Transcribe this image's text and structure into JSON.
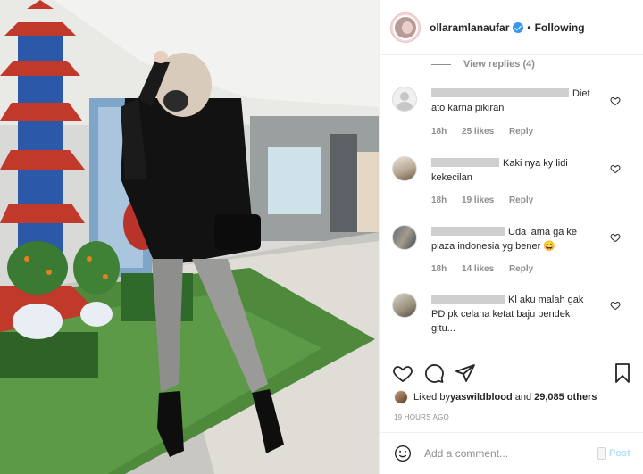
{
  "header": {
    "username": "ollaramlanaufar",
    "separator": "•",
    "follow_state": "Following"
  },
  "view_replies": "View replies (4)",
  "comments": [
    {
      "username": "",
      "text_line1": "Diet",
      "text_line2": "ato karna pikiran",
      "time": "18h",
      "likes": "25 likes",
      "reply": "Reply"
    },
    {
      "username": "",
      "text_line1": "Kaki nya ky lidi",
      "text_line2": "kekecilan",
      "time": "18h",
      "likes": "19 likes",
      "reply": "Reply"
    },
    {
      "username": "",
      "text_line1": "Uda lama ga ke",
      "text_line2": "plaza indonesia yg bener 😄",
      "time": "18h",
      "likes": "14 likes",
      "reply": "Reply"
    },
    {
      "username": "",
      "text_line1": "Kl aku malah gak",
      "text_line2": "PD pk celana ketat baju pendek",
      "text_line3": "gitu..."
    }
  ],
  "likes_bar": {
    "prefix": "Liked by ",
    "liker": "yaswildblood",
    "middle": " and ",
    "count": "29,085 others"
  },
  "timestamp": "19 HOURS AGO",
  "add_comment": {
    "placeholder": "Add a comment...",
    "post_label": "Post"
  },
  "icons": {
    "like": "heart-icon",
    "comment": "comment-bubble-icon",
    "share": "paper-plane-icon",
    "save": "bookmark-icon",
    "emoji": "smiley-icon",
    "verified": "verified-badge-icon"
  },
  "colors": {
    "accent": "#3897f0",
    "post_disabled": "#b2dffc",
    "muted_text": "#8e8e8e",
    "text": "#262626"
  }
}
